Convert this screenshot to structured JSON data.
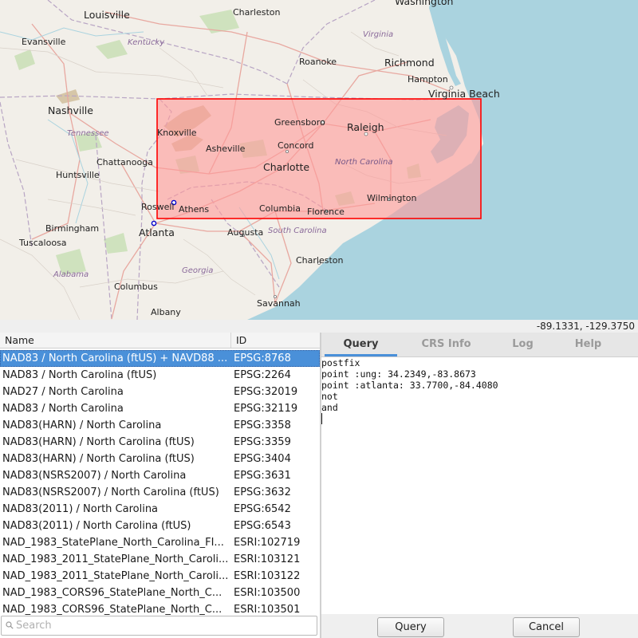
{
  "map": {
    "cities": {
      "louisville": "Louisville",
      "charleston_wv": "Charleston",
      "washington": "Washington",
      "evansville": "Evansville",
      "kentucky": "Kentucky",
      "virginia": "Virginia",
      "roanoke": "Roanoke",
      "richmond": "Richmond",
      "hampton": "Hampton",
      "virginia_beach": "Virginia Beach",
      "nashville": "Nashville",
      "tennessee": "Tennessee",
      "greensboro": "Greensboro",
      "raleigh": "Raleigh",
      "knoxville": "Knoxville",
      "asheville": "Asheville",
      "concord": "Concord",
      "chattanooga": "Chattanooga",
      "charlotte": "Charlotte",
      "north_carolina": "North Carolina",
      "huntsville": "Huntsville",
      "roswell": "Roswell",
      "athens": "Athens",
      "columbia": "Columbia",
      "florence": "Florence",
      "wilmington": "Wilmington",
      "birmingham": "Birmingham",
      "atlanta": "Atlanta",
      "augusta": "Augusta",
      "south_carolina": "South Carolina",
      "tuscaloosa": "Tuscaloosa",
      "charleston_sc": "Charleston",
      "alabama": "Alabama",
      "georgia": "Georgia",
      "columbus": "Columbus",
      "savannah": "Savannah",
      "albany": "Albany"
    },
    "selection_color": "#ff0000",
    "selection_fill": "#ff9999"
  },
  "status": {
    "coordinates": "-89.1331, -129.3750"
  },
  "crs_table": {
    "headers": {
      "name": "Name",
      "id": "ID"
    },
    "rows": [
      {
        "name": "NAD83 / North Carolina (ftUS) + NAVD88 ...",
        "id": "EPSG:8768"
      },
      {
        "name": "NAD83 / North Carolina (ftUS)",
        "id": "EPSG:2264"
      },
      {
        "name": "NAD27 / North Carolina",
        "id": "EPSG:32019"
      },
      {
        "name": "NAD83 / North Carolina",
        "id": "EPSG:32119"
      },
      {
        "name": "NAD83(HARN) / North Carolina",
        "id": "EPSG:3358"
      },
      {
        "name": "NAD83(HARN) / North Carolina (ftUS)",
        "id": "EPSG:3359"
      },
      {
        "name": "NAD83(HARN) / North Carolina (ftUS)",
        "id": "EPSG:3404"
      },
      {
        "name": "NAD83(NSRS2007) / North Carolina",
        "id": "EPSG:3631"
      },
      {
        "name": "NAD83(NSRS2007) / North Carolina (ftUS)",
        "id": "EPSG:3632"
      },
      {
        "name": "NAD83(2011) / North Carolina",
        "id": "EPSG:6542"
      },
      {
        "name": "NAD83(2011) / North Carolina (ftUS)",
        "id": "EPSG:6543"
      },
      {
        "name": "NAD_1983_StatePlane_North_Carolina_FI...",
        "id": "ESRI:102719"
      },
      {
        "name": "NAD_1983_2011_StatePlane_North_Caroli...",
        "id": "ESRI:103121"
      },
      {
        "name": "NAD_1983_2011_StatePlane_North_Caroli...",
        "id": "ESRI:103122"
      },
      {
        "name": "NAD_1983_CORS96_StatePlane_North_C...",
        "id": "ESRI:103500"
      },
      {
        "name": "NAD_1983_CORS96_StatePlane_North_C...",
        "id": "ESRI:103501"
      }
    ],
    "selected_index": 0,
    "search": {
      "placeholder": "Search",
      "value": ""
    }
  },
  "tabs": [
    {
      "label": "Query",
      "active": true
    },
    {
      "label": "CRS Info",
      "active": false
    },
    {
      "label": "Log",
      "active": false
    },
    {
      "label": "Help",
      "active": false
    }
  ],
  "editor": {
    "lines": [
      "postfix",
      "point :ung: 34.2349,-83.8673",
      "point :atlanta: 33.7700,-84.4080",
      "not",
      "and"
    ]
  },
  "buttons": {
    "query": "Query",
    "cancel": "Cancel"
  },
  "colors": {
    "selection_row": "#4a90d9",
    "tab_indicator": "#4a90d9",
    "water": "#aad3df",
    "land": "#f2efe9"
  }
}
